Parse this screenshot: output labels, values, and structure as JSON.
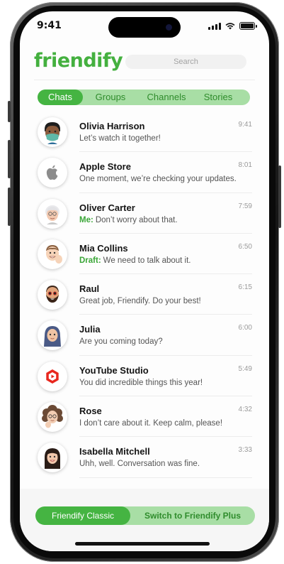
{
  "status_bar": {
    "time": "9:41"
  },
  "app": {
    "logo": "friendify",
    "search_placeholder": "Search"
  },
  "tabs": [
    {
      "label": "Chats",
      "active": true
    },
    {
      "label": "Groups",
      "active": false
    },
    {
      "label": "Channels",
      "active": false
    },
    {
      "label": "Stories",
      "active": false
    }
  ],
  "chats": [
    {
      "name": "Olivia Harrison",
      "prefix": "",
      "message": "Let’s watch it together!",
      "time": "9:41",
      "avatar": "memoji-masked-icon"
    },
    {
      "name": "Apple Store",
      "prefix": "",
      "message": "One moment, we’re checking your updates.",
      "time": "8:01",
      "avatar": "apple-logo-icon"
    },
    {
      "name": "Oliver Carter",
      "prefix": "Me:",
      "message": "Don’t worry about that.",
      "time": "7:59",
      "avatar": "memoji-elder-icon"
    },
    {
      "name": "Mia Collins",
      "prefix": "Draft:",
      "message": "We need to talk about it.",
      "time": "6:50",
      "avatar": "memoji-wave-icon"
    },
    {
      "name": "Raul",
      "prefix": "",
      "message": "Great job, Friendify. Do your best!",
      "time": "6:15",
      "avatar": "memoji-beard-icon"
    },
    {
      "name": "Julia",
      "prefix": "",
      "message": "Are you coming today?",
      "time": "6:00",
      "avatar": "memoji-hijab-icon"
    },
    {
      "name": "YouTube Studio",
      "prefix": "",
      "message": "You did incredible things this year!",
      "time": "5:49",
      "avatar": "youtube-studio-icon"
    },
    {
      "name": "Rose",
      "prefix": "",
      "message": "I don’t care about it. Keep calm, please!",
      "time": "4:32",
      "avatar": "memoji-curly-icon"
    },
    {
      "name": "Isabella Mitchell",
      "prefix": "",
      "message": "Uhh, well. Conversation was fine.",
      "time": "3:33",
      "avatar": "memoji-longhair-icon"
    }
  ],
  "mode_switch": {
    "current": "Friendify Classic",
    "switch": "Switch to Friendify Plus"
  },
  "colors": {
    "brand": "#44b03f",
    "tab_track": "#a8dea5",
    "active": "#45b442"
  }
}
